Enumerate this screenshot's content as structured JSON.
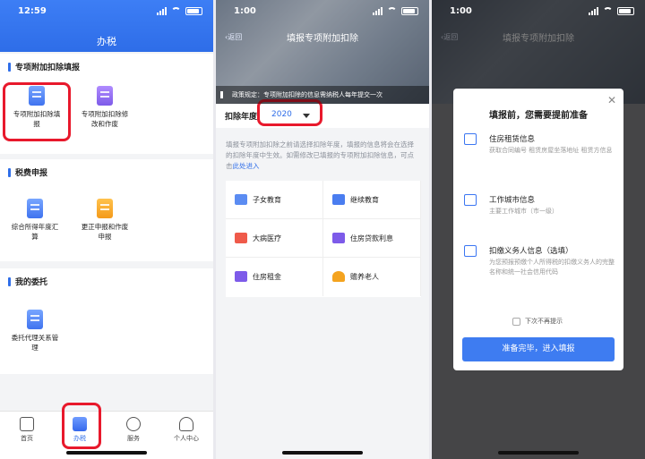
{
  "panel1": {
    "time": "12:59",
    "header_title": "办税",
    "sections": [
      {
        "title": "专项附加扣除填报",
        "tiles": [
          "专项附加扣除填报",
          "专项附加扣除修改和作废"
        ]
      },
      {
        "title": "税费申报",
        "tiles": [
          "综合所得年度汇算",
          "更正申报和作废申报"
        ]
      },
      {
        "title": "我的委托",
        "tiles": [
          "委托代理关系管理"
        ]
      }
    ],
    "tabs": [
      "首页",
      "办税",
      "服务",
      "个人中心"
    ]
  },
  "panel2": {
    "time": "1:00",
    "back_label": "返回",
    "nav_title": "填报专项附加扣除",
    "notice": "政策规定：专项附加扣除的信息需纳税人每年提交一次",
    "year_label": "扣除年度:",
    "year_value": "2020",
    "description": "填报专项附加扣除之前请选择扣除年度，填报的信息将会在选择的扣除年度中生效。如需修改已填报的专项附加扣除信息，可点击",
    "description_link": "此处进入",
    "items": [
      "子女教育",
      "继续教育",
      "大病医疗",
      "住房贷款利息",
      "住房租金",
      "赡养老人"
    ]
  },
  "panel3": {
    "time": "1:00",
    "back_label": "返回",
    "nav_title": "填报专项附加扣除",
    "modal": {
      "title": "填报前，您需要提前准备",
      "items": [
        {
          "heading": "住房租赁信息",
          "text": "获取合同编号 租赁房屋坐落地址 租赁方信息"
        },
        {
          "heading": "工作城市信息",
          "text": "主要工作城市（市一级）"
        },
        {
          "heading": "扣缴义务人信息（选填）",
          "text": "为您预报预缴个人所得税的扣缴义务人的完整名称和统一社会信用代码"
        }
      ],
      "checkbox_label": "下次不再提示",
      "confirm_label": "准备完毕，进入填报"
    }
  },
  "colors": {
    "accent": "#2f6ee9",
    "highlight": "#e8192c"
  }
}
